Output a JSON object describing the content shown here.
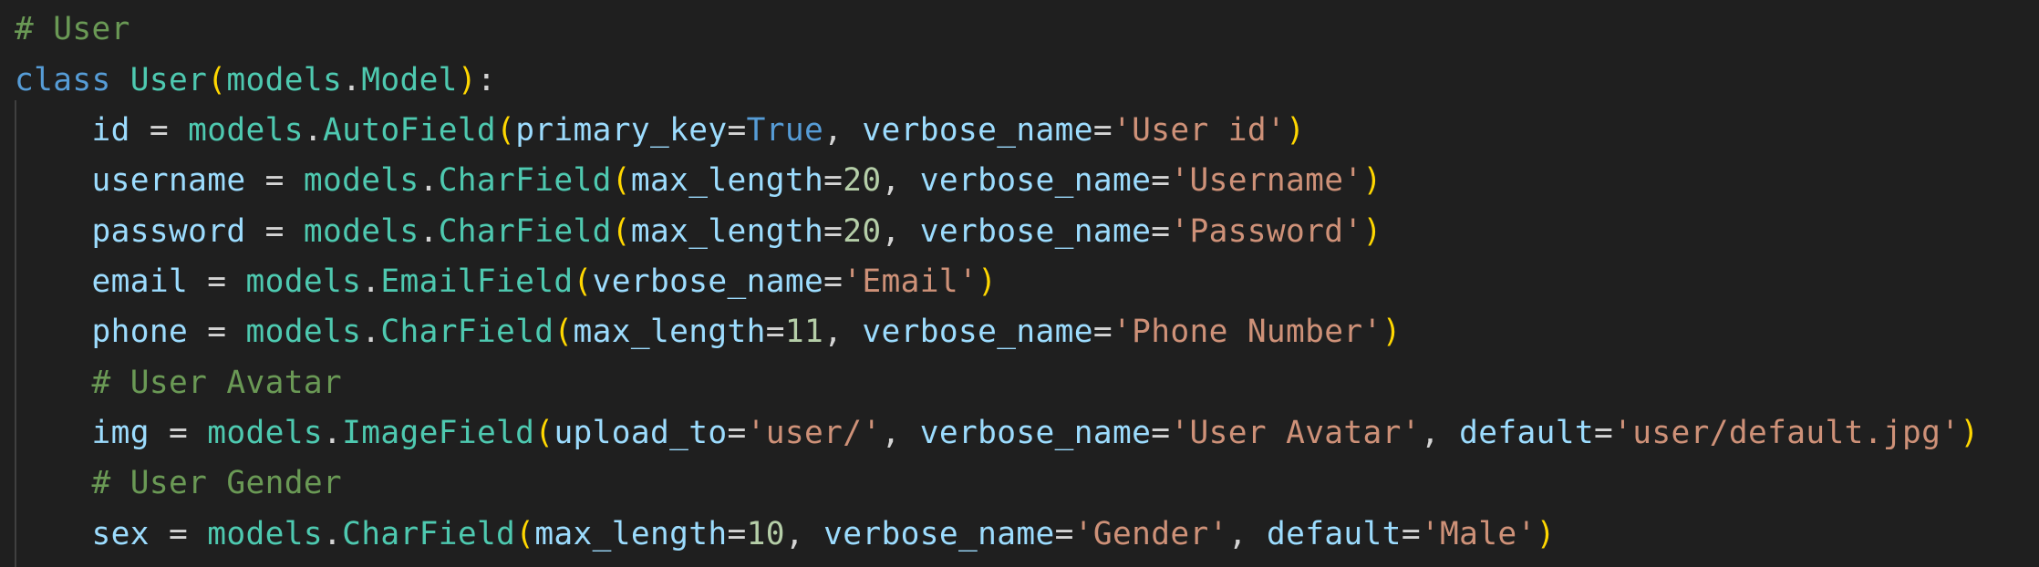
{
  "editor": {
    "background": "#1f1f1f",
    "lines": [
      {
        "tokens": [
          {
            "t": "# User",
            "k": "comment"
          }
        ]
      },
      {
        "tokens": [
          {
            "t": "class",
            "k": "keyword"
          },
          {
            "t": " ",
            "k": "plain"
          },
          {
            "t": "User",
            "k": "class"
          },
          {
            "t": "(",
            "k": "paren"
          },
          {
            "t": "models",
            "k": "class"
          },
          {
            "t": ".",
            "k": "plain"
          },
          {
            "t": "Model",
            "k": "class"
          },
          {
            "t": ")",
            "k": "paren"
          },
          {
            "t": ":",
            "k": "plain"
          }
        ]
      },
      {
        "tokens": [
          {
            "t": "    ",
            "k": "plain"
          },
          {
            "t": "id",
            "k": "var"
          },
          {
            "t": " = ",
            "k": "plain"
          },
          {
            "t": "models",
            "k": "class"
          },
          {
            "t": ".",
            "k": "plain"
          },
          {
            "t": "AutoField",
            "k": "class"
          },
          {
            "t": "(",
            "k": "paren"
          },
          {
            "t": "primary_key",
            "k": "param"
          },
          {
            "t": "=",
            "k": "plain"
          },
          {
            "t": "True",
            "k": "const"
          },
          {
            "t": ", ",
            "k": "plain"
          },
          {
            "t": "verbose_name",
            "k": "param"
          },
          {
            "t": "=",
            "k": "plain"
          },
          {
            "t": "'User id'",
            "k": "string"
          },
          {
            "t": ")",
            "k": "paren"
          }
        ]
      },
      {
        "tokens": [
          {
            "t": "    ",
            "k": "plain"
          },
          {
            "t": "username",
            "k": "var"
          },
          {
            "t": " = ",
            "k": "plain"
          },
          {
            "t": "models",
            "k": "class"
          },
          {
            "t": ".",
            "k": "plain"
          },
          {
            "t": "CharField",
            "k": "class"
          },
          {
            "t": "(",
            "k": "paren"
          },
          {
            "t": "max_length",
            "k": "param"
          },
          {
            "t": "=",
            "k": "plain"
          },
          {
            "t": "20",
            "k": "number"
          },
          {
            "t": ", ",
            "k": "plain"
          },
          {
            "t": "verbose_name",
            "k": "param"
          },
          {
            "t": "=",
            "k": "plain"
          },
          {
            "t": "'Username'",
            "k": "string"
          },
          {
            "t": ")",
            "k": "paren"
          }
        ]
      },
      {
        "tokens": [
          {
            "t": "    ",
            "k": "plain"
          },
          {
            "t": "password",
            "k": "var"
          },
          {
            "t": " = ",
            "k": "plain"
          },
          {
            "t": "models",
            "k": "class"
          },
          {
            "t": ".",
            "k": "plain"
          },
          {
            "t": "CharField",
            "k": "class"
          },
          {
            "t": "(",
            "k": "paren"
          },
          {
            "t": "max_length",
            "k": "param"
          },
          {
            "t": "=",
            "k": "plain"
          },
          {
            "t": "20",
            "k": "number"
          },
          {
            "t": ", ",
            "k": "plain"
          },
          {
            "t": "verbose_name",
            "k": "param"
          },
          {
            "t": "=",
            "k": "plain"
          },
          {
            "t": "'Password'",
            "k": "string"
          },
          {
            "t": ")",
            "k": "paren"
          }
        ]
      },
      {
        "tokens": [
          {
            "t": "    ",
            "k": "plain"
          },
          {
            "t": "email",
            "k": "var"
          },
          {
            "t": " = ",
            "k": "plain"
          },
          {
            "t": "models",
            "k": "class"
          },
          {
            "t": ".",
            "k": "plain"
          },
          {
            "t": "EmailField",
            "k": "class"
          },
          {
            "t": "(",
            "k": "paren"
          },
          {
            "t": "verbose_name",
            "k": "param"
          },
          {
            "t": "=",
            "k": "plain"
          },
          {
            "t": "'Email'",
            "k": "string"
          },
          {
            "t": ")",
            "k": "paren"
          }
        ]
      },
      {
        "tokens": [
          {
            "t": "    ",
            "k": "plain"
          },
          {
            "t": "phone",
            "k": "var"
          },
          {
            "t": " = ",
            "k": "plain"
          },
          {
            "t": "models",
            "k": "class"
          },
          {
            "t": ".",
            "k": "plain"
          },
          {
            "t": "CharField",
            "k": "class"
          },
          {
            "t": "(",
            "k": "paren"
          },
          {
            "t": "max_length",
            "k": "param"
          },
          {
            "t": "=",
            "k": "plain"
          },
          {
            "t": "11",
            "k": "number"
          },
          {
            "t": ", ",
            "k": "plain"
          },
          {
            "t": "verbose_name",
            "k": "param"
          },
          {
            "t": "=",
            "k": "plain"
          },
          {
            "t": "'Phone Number'",
            "k": "string"
          },
          {
            "t": ")",
            "k": "paren"
          }
        ]
      },
      {
        "tokens": [
          {
            "t": "    ",
            "k": "plain"
          },
          {
            "t": "# User Avatar",
            "k": "comment"
          }
        ]
      },
      {
        "tokens": [
          {
            "t": "    ",
            "k": "plain"
          },
          {
            "t": "img",
            "k": "var"
          },
          {
            "t": " = ",
            "k": "plain"
          },
          {
            "t": "models",
            "k": "class"
          },
          {
            "t": ".",
            "k": "plain"
          },
          {
            "t": "ImageField",
            "k": "class"
          },
          {
            "t": "(",
            "k": "paren"
          },
          {
            "t": "upload_to",
            "k": "param"
          },
          {
            "t": "=",
            "k": "plain"
          },
          {
            "t": "'user/'",
            "k": "string"
          },
          {
            "t": ", ",
            "k": "plain"
          },
          {
            "t": "verbose_name",
            "k": "param"
          },
          {
            "t": "=",
            "k": "plain"
          },
          {
            "t": "'User Avatar'",
            "k": "string"
          },
          {
            "t": ", ",
            "k": "plain"
          },
          {
            "t": "default",
            "k": "param"
          },
          {
            "t": "=",
            "k": "plain"
          },
          {
            "t": "'user/default.jpg'",
            "k": "string"
          },
          {
            "t": ")",
            "k": "paren"
          }
        ]
      },
      {
        "tokens": [
          {
            "t": "    ",
            "k": "plain"
          },
          {
            "t": "# User Gender",
            "k": "comment"
          }
        ]
      },
      {
        "tokens": [
          {
            "t": "    ",
            "k": "plain"
          },
          {
            "t": "sex",
            "k": "var"
          },
          {
            "t": " = ",
            "k": "plain"
          },
          {
            "t": "models",
            "k": "class"
          },
          {
            "t": ".",
            "k": "plain"
          },
          {
            "t": "CharField",
            "k": "class"
          },
          {
            "t": "(",
            "k": "paren"
          },
          {
            "t": "max_length",
            "k": "param"
          },
          {
            "t": "=",
            "k": "plain"
          },
          {
            "t": "10",
            "k": "number"
          },
          {
            "t": ", ",
            "k": "plain"
          },
          {
            "t": "verbose_name",
            "k": "param"
          },
          {
            "t": "=",
            "k": "plain"
          },
          {
            "t": "'Gender'",
            "k": "string"
          },
          {
            "t": ", ",
            "k": "plain"
          },
          {
            "t": "default",
            "k": "param"
          },
          {
            "t": "=",
            "k": "plain"
          },
          {
            "t": "'Male'",
            "k": "string"
          },
          {
            "t": ")",
            "k": "paren"
          }
        ]
      }
    ]
  }
}
